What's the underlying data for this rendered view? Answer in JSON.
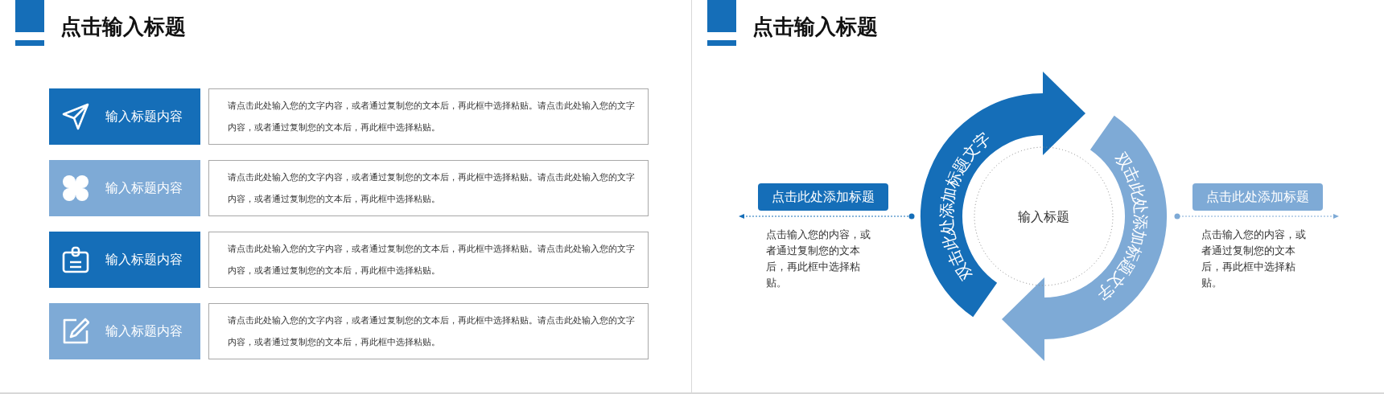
{
  "left_slide": {
    "title": "点击输入标题",
    "items": [
      {
        "label": "输入标题内容",
        "color": "#156eb8",
        "text": "请点击此处输入您的文字内容，或者通过复制您的文本后，再此框中选择粘贴。请点击此处输入您的文字内容，或者通过复制您的文本后，再此框中选择粘贴。"
      },
      {
        "label": "输入标题内容",
        "color": "#7eaad6",
        "text": "请点击此处输入您的文字内容，或者通过复制您的文本后，再此框中选择粘贴。请点击此处输入您的文字内容，或者通过复制您的文本后，再此框中选择粘贴。"
      },
      {
        "label": "输入标题内容",
        "color": "#156eb8",
        "text": "请点击此处输入您的文字内容，或者通过复制您的文本后，再此框中选择粘贴。请点击此处输入您的文字内容，或者通过复制您的文本后，再此框中选择粘贴。"
      },
      {
        "label": "输入标题内容",
        "color": "#7eaad6",
        "text": "请点击此处输入您的文字内容，或者通过复制您的文本后，再此框中选择粘贴。请点击此处输入您的文字内容，或者通过复制您的文本后，再此框中选择粘贴。"
      }
    ]
  },
  "right_slide": {
    "title": "点击输入标题",
    "cycle": {
      "center": "输入标题",
      "arrows": [
        {
          "text": "双击此处添加标题文字",
          "color": "#156eb8"
        },
        {
          "text": "双击此处添加标题文字",
          "color": "#7eaad6"
        }
      ]
    },
    "callouts": [
      {
        "title": "点击此处添加标题",
        "color": "#156eb8",
        "text": "点击输入您的内容，或者通过复制您的文本后，再此框中选择粘贴。"
      },
      {
        "title": "点击此处添加标题",
        "color": "#7eaad6",
        "text": "点击输入您的内容，或者通过复制您的文本后，再此框中选择粘贴。"
      }
    ]
  }
}
